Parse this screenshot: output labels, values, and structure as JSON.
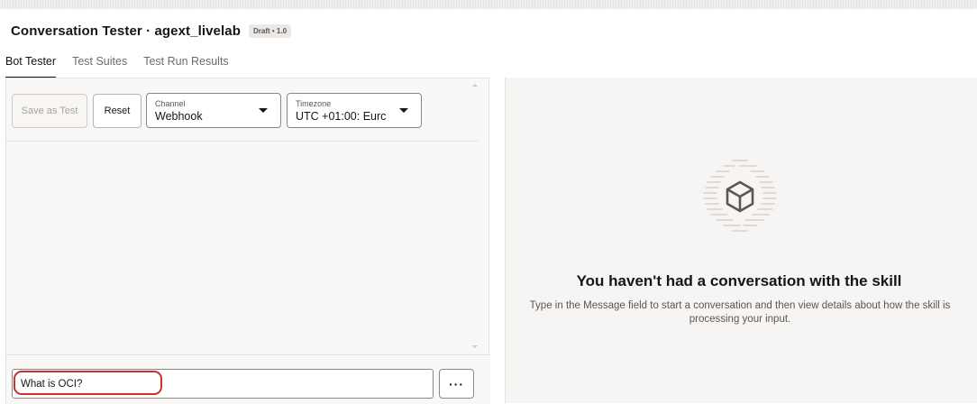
{
  "header": {
    "title": "Conversation Tester · agext_livelab",
    "badge": "Draft • 1.0"
  },
  "tabs": [
    {
      "label": "Bot Tester",
      "active": true
    },
    {
      "label": "Test Suites",
      "active": false
    },
    {
      "label": "Test Run Results",
      "active": false
    }
  ],
  "toolbar": {
    "save_label": "Save as Test",
    "reset_label": "Reset",
    "channel": {
      "label": "Channel",
      "value": "Webhook"
    },
    "timezone": {
      "label": "Timezone",
      "value": "UTC +01:00: Eurc"
    }
  },
  "message": {
    "value": "What is OCI?",
    "more_label": "···"
  },
  "empty_state": {
    "title": "You haven't had a conversation with the skill",
    "description": "Type in the Message field to start a conversation and then view details about how the skill is processing your input.",
    "icon": "cube-icon"
  },
  "colors": {
    "highlight": "#c9302c",
    "panel_bg": "#f9f8f6",
    "right_bg": "#f6f5f3"
  }
}
